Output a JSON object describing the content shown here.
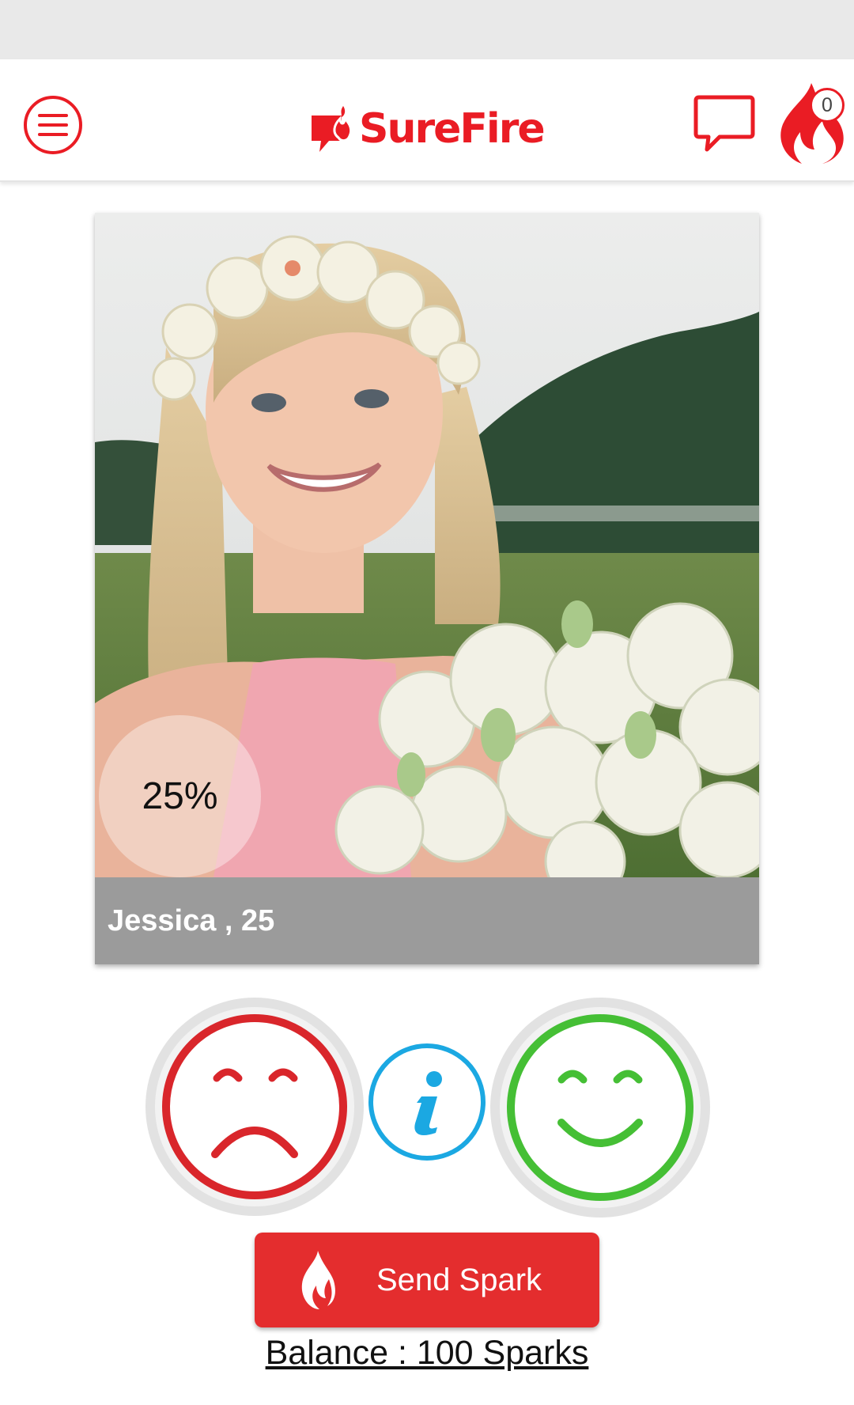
{
  "app": {
    "name": "SureFire",
    "brand_color": "#ea1c24"
  },
  "header": {
    "icons": [
      "menu-icon",
      "logo-icon",
      "chat-icon",
      "flame-icon"
    ],
    "spark_count": "0"
  },
  "profile": {
    "name_age": "Jessica , 25",
    "match_percent": "25%",
    "photo_description": "smiling woman with flower crown"
  },
  "actions": {
    "icons": [
      "sad-face-icon",
      "info-icon",
      "happy-face-icon",
      "flame-icon"
    ],
    "dislike_color": "#d9262b",
    "like_color": "#45bf35",
    "info_color": "#1ba8e2",
    "send_spark_label": "Send Spark"
  },
  "balance": {
    "label": "Balance : 100 Sparks"
  }
}
